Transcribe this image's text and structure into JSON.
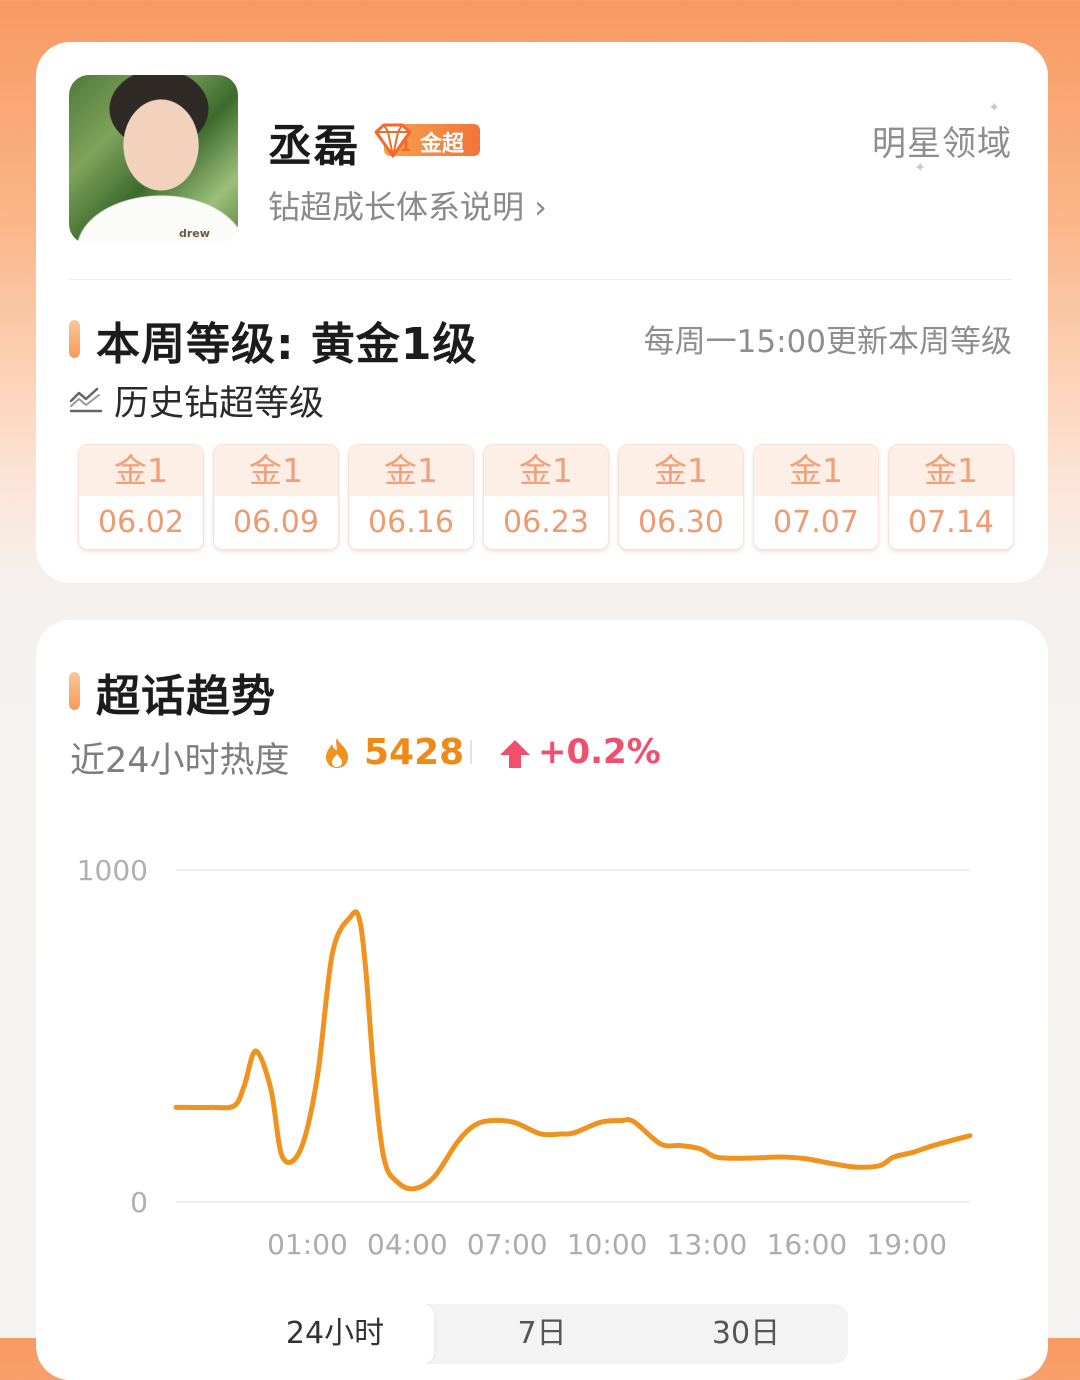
{
  "profile": {
    "name": "丞磊",
    "badge_text": "金超",
    "badge_level": "1",
    "growth_link": "钻超成长体系说明 ›",
    "domain_label": "明星领域",
    "avatar_shirt_text": "drew"
  },
  "level": {
    "title": "本周等级: 黄金1级",
    "update_note": "每周一15:00更新本周等级",
    "history_label": "历史钻超等级",
    "weeks": [
      {
        "level": "金1",
        "date": "06.02"
      },
      {
        "level": "金1",
        "date": "06.09"
      },
      {
        "level": "金1",
        "date": "06.16"
      },
      {
        "level": "金1",
        "date": "06.23"
      },
      {
        "level": "金1",
        "date": "06.30"
      },
      {
        "level": "金1",
        "date": "07.07"
      },
      {
        "level": "金1",
        "date": "07.14"
      }
    ]
  },
  "trend": {
    "title": "超话趋势",
    "heat_label": "近24小时热度",
    "heat_value": "5428",
    "heat_change": "+0.2%",
    "tabs": [
      "24小时",
      "7日",
      "30日"
    ],
    "active_tab": 0
  },
  "colors": {
    "accent": "#f0921e",
    "line": "#f0921e",
    "up": "#f0506e",
    "week_text": "#ee9b72"
  },
  "chart_data": {
    "type": "line",
    "ylim": [
      0,
      1000
    ],
    "y_ticks": [
      "0",
      "1000"
    ],
    "x_ticks": [
      "01:00",
      "04:00",
      "07:00",
      "10:00",
      "13:00",
      "16:00",
      "19:00"
    ],
    "xlim_hours": [
      -2.95,
      20.9
    ],
    "series": [
      {
        "x": [
          -2.95,
          -1.9,
          -1.2,
          -0.9,
          -0.55,
          -0.1,
          0.25,
          0.8,
          1.3,
          1.75,
          2.3,
          2.55,
          2.75,
          3.0,
          3.3,
          3.7,
          4.2,
          4.8,
          5.5,
          6.0,
          6.5,
          7.2,
          8.0,
          8.6,
          9.0,
          9.8,
          10.4,
          10.8,
          11.6,
          12.2,
          12.8,
          13.3,
          14.2,
          15.0,
          15.4,
          16.0,
          16.8,
          17.5,
          18.2,
          18.6,
          19.2,
          19.8,
          20.9
        ],
        "values": [
          285,
          285,
          290,
          350,
          455,
          340,
          135,
          160,
          380,
          750,
          860,
          855,
          700,
          380,
          130,
          60,
          40,
          75,
          180,
          230,
          245,
          240,
          205,
          205,
          208,
          240,
          245,
          242,
          175,
          170,
          160,
          135,
          132,
          135,
          135,
          130,
          115,
          105,
          110,
          135,
          150,
          170,
          200
        ]
      }
    ]
  }
}
